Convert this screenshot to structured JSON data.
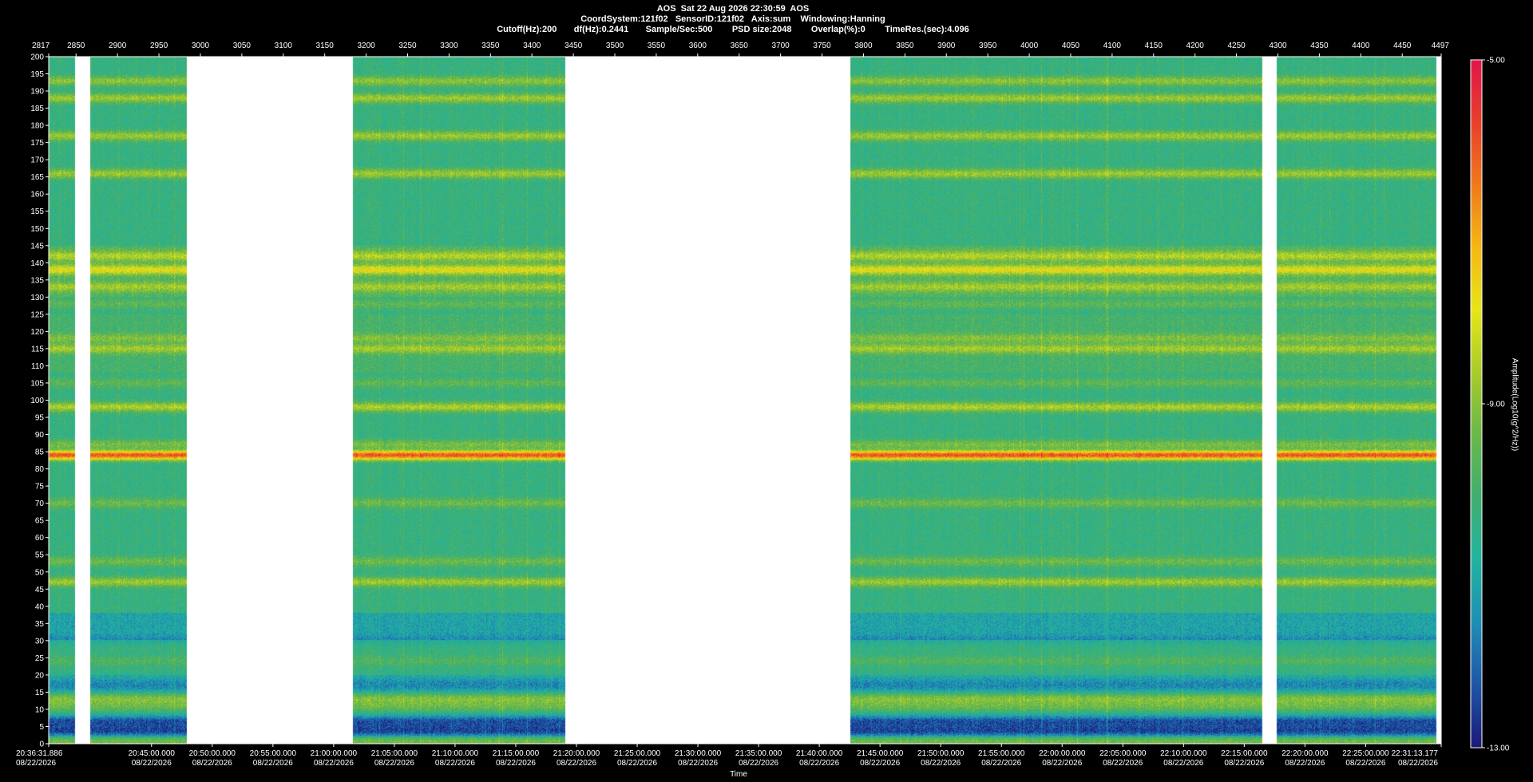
{
  "header": {
    "line1": "AOS  Sat 22 Aug 2026 22:30:59  AOS",
    "line2": "CoordSystem:121f02   SensorID:121f02   Axis:sum    Windowing:Hanning",
    "line3": "Cutoff(Hz):200       df(Hz):0.2441       Sample/Sec:500        PSD size:2048        Overlap(%):0        TimeRes.(sec):4.096"
  },
  "chart_data": {
    "type": "heatmap",
    "title": "AOS  Sat 22 Aug 2026 22:30:59  AOS",
    "xlabel": "Time",
    "ylabel": "",
    "colorbar_label": "Amplitude(Log10(g^2/Hz))",
    "ylim": [
      0,
      200
    ],
    "y_ticks": [
      0,
      5,
      10,
      15,
      20,
      25,
      30,
      35,
      40,
      45,
      50,
      55,
      60,
      65,
      70,
      75,
      80,
      85,
      90,
      95,
      100,
      105,
      110,
      115,
      120,
      125,
      130,
      135,
      140,
      145,
      150,
      155,
      160,
      165,
      170,
      175,
      180,
      185,
      190,
      195,
      200
    ],
    "top_axis": {
      "xlim": [
        2817,
        4497
      ],
      "tick_labels": [
        "2817",
        "2850",
        "2900",
        "2950",
        "3000",
        "3050",
        "3100",
        "3150",
        "3200",
        "3250",
        "3300",
        "3350",
        "3400",
        "3450",
        "3500",
        "3550",
        "3600",
        "3650",
        "3700",
        "3750",
        "3800",
        "3850",
        "3900",
        "3950",
        "4000",
        "4050",
        "4100",
        "4150",
        "4200",
        "4250",
        "4300",
        "4350",
        "4400",
        "4450",
        "4497"
      ],
      "tick_values": [
        2817,
        2850,
        2900,
        2950,
        3000,
        3050,
        3100,
        3150,
        3200,
        3250,
        3300,
        3350,
        3400,
        3450,
        3500,
        3550,
        3600,
        3650,
        3700,
        3750,
        3800,
        3850,
        3900,
        3950,
        4000,
        4050,
        4100,
        4150,
        4200,
        4250,
        4300,
        4350,
        4400,
        4450,
        4497
      ]
    },
    "bottom_axis": {
      "xlim": [
        "20:36:31.886",
        "22:31:13.177"
      ],
      "date": "08/22/2026",
      "tick_labels": [
        "20:36:31.886",
        "20:45:00.000",
        "20:50:00.000",
        "20:55:00.000",
        "21:00:00.000",
        "21:05:00.000",
        "21:10:00.000",
        "21:15:00.000",
        "21:20:00.000",
        "21:25:00.000",
        "21:30:00.000",
        "21:35:00.000",
        "21:40:00.000",
        "21:45:00.000",
        "21:50:00.000",
        "21:55:00.000",
        "22:00:00.000",
        "22:05:00.000",
        "22:10:00.000",
        "22:15:00.000",
        "22:20:00.000",
        "22:25:00.000",
        "22:31:13.177"
      ],
      "tick_dates": [
        "08/22/2026",
        "08/22/2026",
        "08/22/2026",
        "08/22/2026",
        "08/22/2026",
        "08/22/2026",
        "08/22/2026",
        "08/22/2026",
        "08/22/2026",
        "08/22/2026",
        "08/22/2026",
        "08/22/2026",
        "08/22/2026",
        "08/22/2026",
        "08/22/2026",
        "08/22/2026",
        "08/22/2026",
        "08/22/2026",
        "08/22/2026",
        "08/22/2026",
        "08/22/2026",
        "08/22/2026",
        "08/22/2026"
      ]
    },
    "colorbar": {
      "range": [
        -13.0,
        -5.0
      ],
      "tick_labels": [
        "-5.00",
        "-9.00",
        "-13.00"
      ],
      "tick_values": [
        -5.0,
        -9.0,
        -13.0
      ],
      "colormap": [
        "#1a1a7a",
        "#1e56a8",
        "#1e8fb5",
        "#22b3a0",
        "#3fae70",
        "#6ab84a",
        "#a8cc2a",
        "#e6e619",
        "#f5b814",
        "#f07a1c",
        "#e8402a",
        "#e0164a"
      ]
    },
    "data_segments_x": [
      [
        2817,
        2849
      ],
      [
        2867,
        2984
      ],
      [
        3184,
        3440
      ],
      [
        3784,
        4281
      ],
      [
        4299,
        4491
      ]
    ],
    "gap_segments_x": [
      [
        2849,
        2867
      ],
      [
        2984,
        3184
      ],
      [
        3440,
        3784
      ],
      [
        4281,
        4299
      ]
    ],
    "background_level": -10.3,
    "horizontal_bands_hz": [
      {
        "hz": 1,
        "level": -9.0
      },
      {
        "hz": 4,
        "level": -12.2
      },
      {
        "hz": 6,
        "level": -12.0
      },
      {
        "hz": 11,
        "level": -9.2
      },
      {
        "hz": 13,
        "level": -8.6
      },
      {
        "hz": 17,
        "level": -11.2
      },
      {
        "hz": 24,
        "level": -9.8
      },
      {
        "hz": 30,
        "level": -10.8
      },
      {
        "hz": 47,
        "level": -8.8
      },
      {
        "hz": 53,
        "level": -9.4
      },
      {
        "hz": 70,
        "level": -9.4
      },
      {
        "hz": 84,
        "level": -6.0
      },
      {
        "hz": 87,
        "level": -9.2
      },
      {
        "hz": 98,
        "level": -8.6
      },
      {
        "hz": 105,
        "level": -9.6
      },
      {
        "hz": 115,
        "level": -9.0
      },
      {
        "hz": 118,
        "level": -9.4
      },
      {
        "hz": 128,
        "level": -9.6
      },
      {
        "hz": 133,
        "level": -9.2
      },
      {
        "hz": 138,
        "level": -8.4
      },
      {
        "hz": 142,
        "level": -9.0
      },
      {
        "hz": 166,
        "level": -8.8
      },
      {
        "hz": 177,
        "level": -8.8
      },
      {
        "hz": 188,
        "level": -8.8
      },
      {
        "hz": 193,
        "level": -9.0
      }
    ]
  }
}
